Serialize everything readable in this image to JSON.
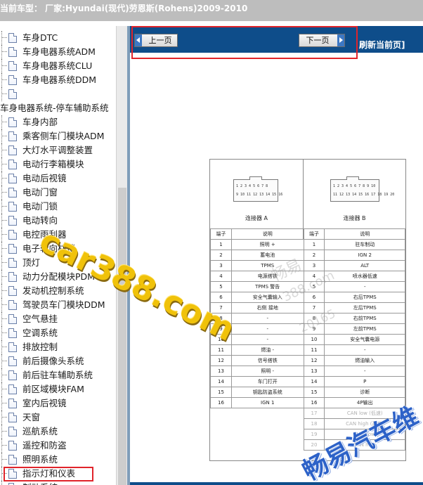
{
  "title_bar": {
    "text": "当前车型： 厂家:Hyundai(现代)劳恩斯(Rohens)2009-2010"
  },
  "sidebar": {
    "items": [
      {
        "label": "车身DTC",
        "type": "doc"
      },
      {
        "label": "车身电器系统ADM",
        "type": "doc"
      },
      {
        "label": "车身电器系统CLU",
        "type": "doc"
      },
      {
        "label": "车身电器系统DDM",
        "type": "doc"
      },
      {
        "label": "",
        "type": "doc"
      },
      {
        "label": "车身电器系统-停车辅助系统",
        "type": "category"
      },
      {
        "label": "车身内部",
        "type": "doc"
      },
      {
        "label": "乘客侧车门模块ADM",
        "type": "doc"
      },
      {
        "label": "大灯水平调整装置",
        "type": "doc"
      },
      {
        "label": "电动行李箱模块",
        "type": "doc"
      },
      {
        "label": "电动后视镜",
        "type": "doc"
      },
      {
        "label": "电动门窗",
        "type": "doc"
      },
      {
        "label": "电动门锁",
        "type": "doc"
      },
      {
        "label": "电动转向",
        "type": "doc"
      },
      {
        "label": "电控雨刮器",
        "type": "doc"
      },
      {
        "label": "电子转向柱锁",
        "type": "doc"
      },
      {
        "label": "顶灯",
        "type": "doc"
      },
      {
        "label": "动力分配模块PDM",
        "type": "doc"
      },
      {
        "label": "发动机控制系统",
        "type": "doc"
      },
      {
        "label": "驾驶员车门模块DDM",
        "type": "doc"
      },
      {
        "label": "空气悬挂",
        "type": "doc"
      },
      {
        "label": "空调系统",
        "type": "doc"
      },
      {
        "label": "排放控制",
        "type": "doc"
      },
      {
        "label": "前后摄像头系统",
        "type": "doc"
      },
      {
        "label": "前后驻车辅助系统",
        "type": "doc"
      },
      {
        "label": "前区域模块FAM",
        "type": "doc"
      },
      {
        "label": "室内后视镜",
        "type": "doc"
      },
      {
        "label": "天窗",
        "type": "doc"
      },
      {
        "label": "巡航系统",
        "type": "doc"
      },
      {
        "label": "遥控和防盗",
        "type": "doc"
      },
      {
        "label": "照明系统",
        "type": "doc"
      },
      {
        "label": "指示灯和仪表",
        "type": "doc",
        "highlighted": true
      },
      {
        "label": "制动系统",
        "type": "doc"
      }
    ]
  },
  "toolbar": {
    "prev_label": "上一页",
    "next_label": "下一页",
    "refresh_label": "刷新当前页]"
  },
  "document": {
    "connector_a": {
      "title": "连接器 A",
      "pins_row1": "1 2 3 4 5 6 7 8",
      "pins_row2": "9 10 11 12 13 14 15 16"
    },
    "connector_b": {
      "title": "连接器 B",
      "pins_row1": "1 2 3 4 5 6 7 8 9 10",
      "pins_row2": "11 12 13 14 15 16 17 18 19 20"
    },
    "header": {
      "pin": "端子",
      "desc": "说明"
    },
    "rows_a": [
      [
        "1",
        "照明 +"
      ],
      [
        "2",
        "蓄电池"
      ],
      [
        "3",
        "TPMS"
      ],
      [
        "4",
        "电源搭铁"
      ],
      [
        "5",
        "TPMS 警告"
      ],
      [
        "6",
        "安全气囊输入"
      ],
      [
        "7",
        "右侧 接地"
      ],
      [
        "8",
        "-"
      ],
      [
        "9",
        "-"
      ],
      [
        "10",
        "-"
      ],
      [
        "11",
        "燃油 -"
      ],
      [
        "12",
        "信号搭铁"
      ],
      [
        "13",
        "照明 -"
      ],
      [
        "14",
        "车门打开"
      ],
      [
        "15",
        "钥匙防盗系统"
      ],
      [
        "16",
        "IGN 1"
      ]
    ],
    "rows_b": [
      [
        "1",
        "驻车制动"
      ],
      [
        "2",
        "IGN 2"
      ],
      [
        "3",
        "ALT"
      ],
      [
        "4",
        "喷水器低速"
      ],
      [
        "5",
        "-"
      ],
      [
        "6",
        "右后TPMS"
      ],
      [
        "7",
        "左后TPMS"
      ],
      [
        "8",
        "右前TPMS"
      ],
      [
        "9",
        "左前TPMS"
      ],
      [
        "10",
        "安全气囊电源"
      ],
      [
        "11",
        "-"
      ],
      [
        "12",
        "燃油输入"
      ],
      [
        "13",
        "-"
      ],
      [
        "14",
        "P"
      ],
      [
        "15",
        "诊断"
      ],
      [
        "16",
        "4P输出"
      ],
      [
        "17",
        "CAN low (低速)"
      ],
      [
        "18",
        "CAN high (高速)"
      ],
      [
        "19",
        "CAN low"
      ],
      [
        "20",
        "CAN high"
      ]
    ]
  },
  "watermarks": {
    "main": "car388.com",
    "faint1": "畅易",
    "faint2": "388.com",
    "faint3": "20165",
    "brand": "畅易汽车维"
  },
  "colors": {
    "toolbar_bg": "#0e4d8a",
    "highlight_red": "#e0242b",
    "watermark_yellow": "#f0c20a",
    "brand_blue": "#2d62c8"
  }
}
